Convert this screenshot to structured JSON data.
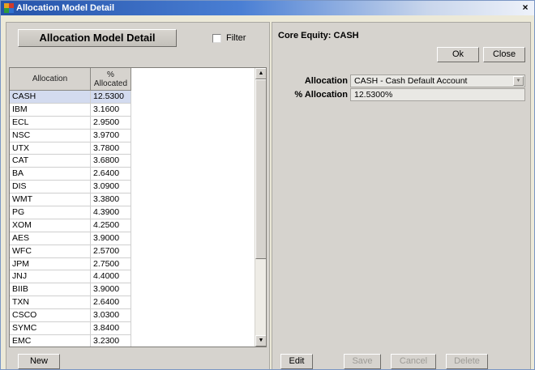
{
  "window": {
    "title": "Allocation Model Detail",
    "close_glyph": "×",
    "app_icon": "colored-squares-icon"
  },
  "left": {
    "header_title": "Allocation Model Detail",
    "filter_label": "Filter",
    "filter_checked": false,
    "columns": {
      "allocation": "Allocation",
      "pct_line1": "%",
      "pct_line2": "Allocated"
    },
    "rows": [
      {
        "name": "CASH",
        "pct": "12.5300"
      },
      {
        "name": "IBM",
        "pct": "3.1600"
      },
      {
        "name": "ECL",
        "pct": "2.9500"
      },
      {
        "name": "NSC",
        "pct": "3.9700"
      },
      {
        "name": "UTX",
        "pct": "3.7800"
      },
      {
        "name": "CAT",
        "pct": "3.6800"
      },
      {
        "name": "BA",
        "pct": "2.6400"
      },
      {
        "name": "DIS",
        "pct": "3.0900"
      },
      {
        "name": "WMT",
        "pct": "3.3800"
      },
      {
        "name": "PG",
        "pct": "4.3900"
      },
      {
        "name": "XOM",
        "pct": "4.2500"
      },
      {
        "name": "AES",
        "pct": "3.9000"
      },
      {
        "name": "WFC",
        "pct": "2.5700"
      },
      {
        "name": "JPM",
        "pct": "2.7500"
      },
      {
        "name": "JNJ",
        "pct": "4.4000"
      },
      {
        "name": "BIIB",
        "pct": "3.9000"
      },
      {
        "name": "TXN",
        "pct": "2.6400"
      },
      {
        "name": "CSCO",
        "pct": "3.0300"
      },
      {
        "name": "SYMC",
        "pct": "3.8400"
      },
      {
        "name": "EMC",
        "pct": "3.2300"
      }
    ],
    "selected_row": 0,
    "new_label": "New",
    "scroll_up_glyph": "▲",
    "scroll_down_glyph": "▼"
  },
  "right": {
    "title": "Core Equity: CASH",
    "ok_label": "Ok",
    "close_label": "Close",
    "allocation_label": "Allocation",
    "allocation_value": "CASH - Cash Default Account",
    "pct_label": "% Allocation",
    "pct_value": "12.5300%",
    "dropdown_glyph": "▼",
    "edit_label": "Edit",
    "save_label": "Save",
    "cancel_label": "Cancel",
    "delete_label": "Delete"
  }
}
